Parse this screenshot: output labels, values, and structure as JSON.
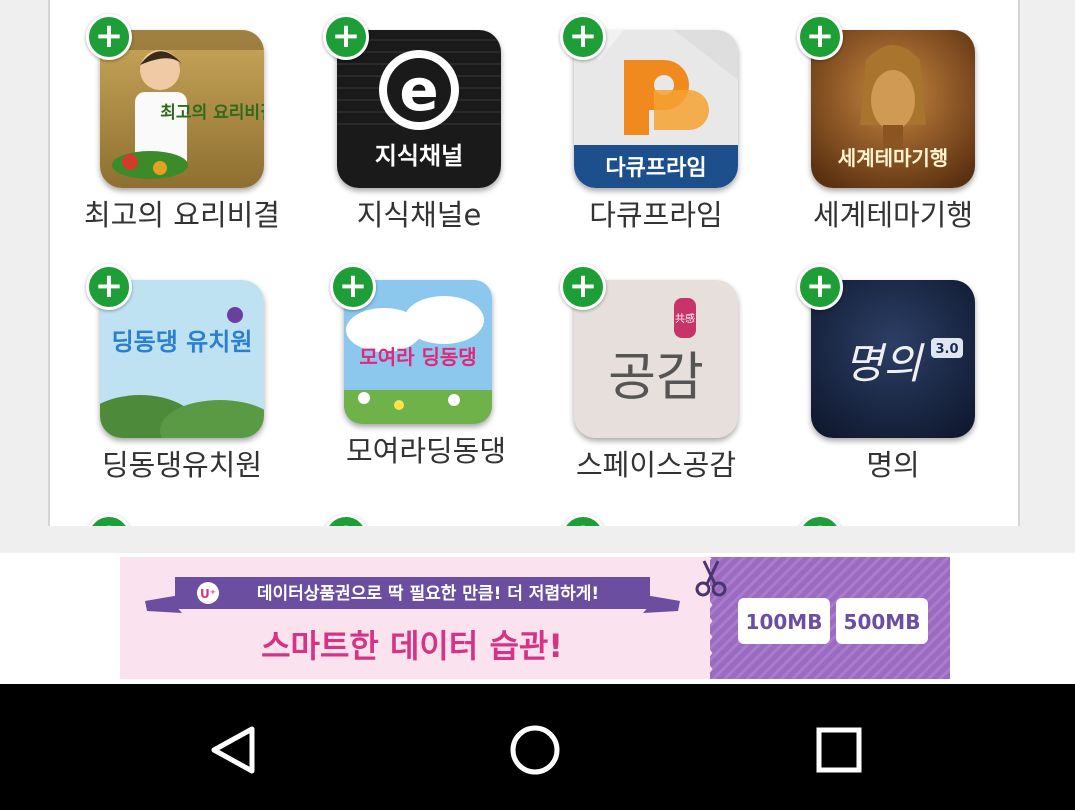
{
  "apps": [
    {
      "name": "최고의 요리비결",
      "thumb_text": "최고의 요리비결",
      "icon": "cooking-show-thumbnail"
    },
    {
      "name": "지식채널e",
      "thumb_text": "지식채널",
      "icon": "e-channel-thumbnail"
    },
    {
      "name": "다큐프라임",
      "thumb_text": "다큐프라임",
      "icon": "docuprime-thumbnail"
    },
    {
      "name": "세계테마기행",
      "thumb_text": "세계테마기행",
      "icon": "world-theme-travel-thumbnail"
    },
    {
      "name": "딩동댕유치원",
      "thumb_text": "딩동댕 유치원",
      "icon": "dingdongdaeng-kindergarten-thumbnail"
    },
    {
      "name": "모여라딩동댕",
      "thumb_text": "모여라 딩동댕",
      "icon": "moyeora-dingdongdaeng-thumbnail"
    },
    {
      "name": "스페이스공감",
      "thumb_text": "공감",
      "thumb_small": "共感",
      "icon": "space-gonggam-thumbnail"
    },
    {
      "name": "명의",
      "thumb_text": "명의",
      "thumb_small": "3.0",
      "icon": "myeongui-thumbnail"
    }
  ],
  "add_button_glyph": "+",
  "ad": {
    "logo": "U⁺",
    "top_line": "데이터상품권으로 딱 필요한 만큼! 더 저렴하게!",
    "headline": "스마트한 데이터 습관!",
    "option_1": "100MB",
    "option_2": "500MB",
    "icon": "scissors-icon",
    "colors": {
      "pink": "#fbe2ef",
      "purple": "#9c6ac0",
      "accent": "#d63384"
    }
  },
  "navbar": {
    "back": "back-triangle-icon",
    "home": "home-circle-icon",
    "recents": "recents-square-icon"
  }
}
